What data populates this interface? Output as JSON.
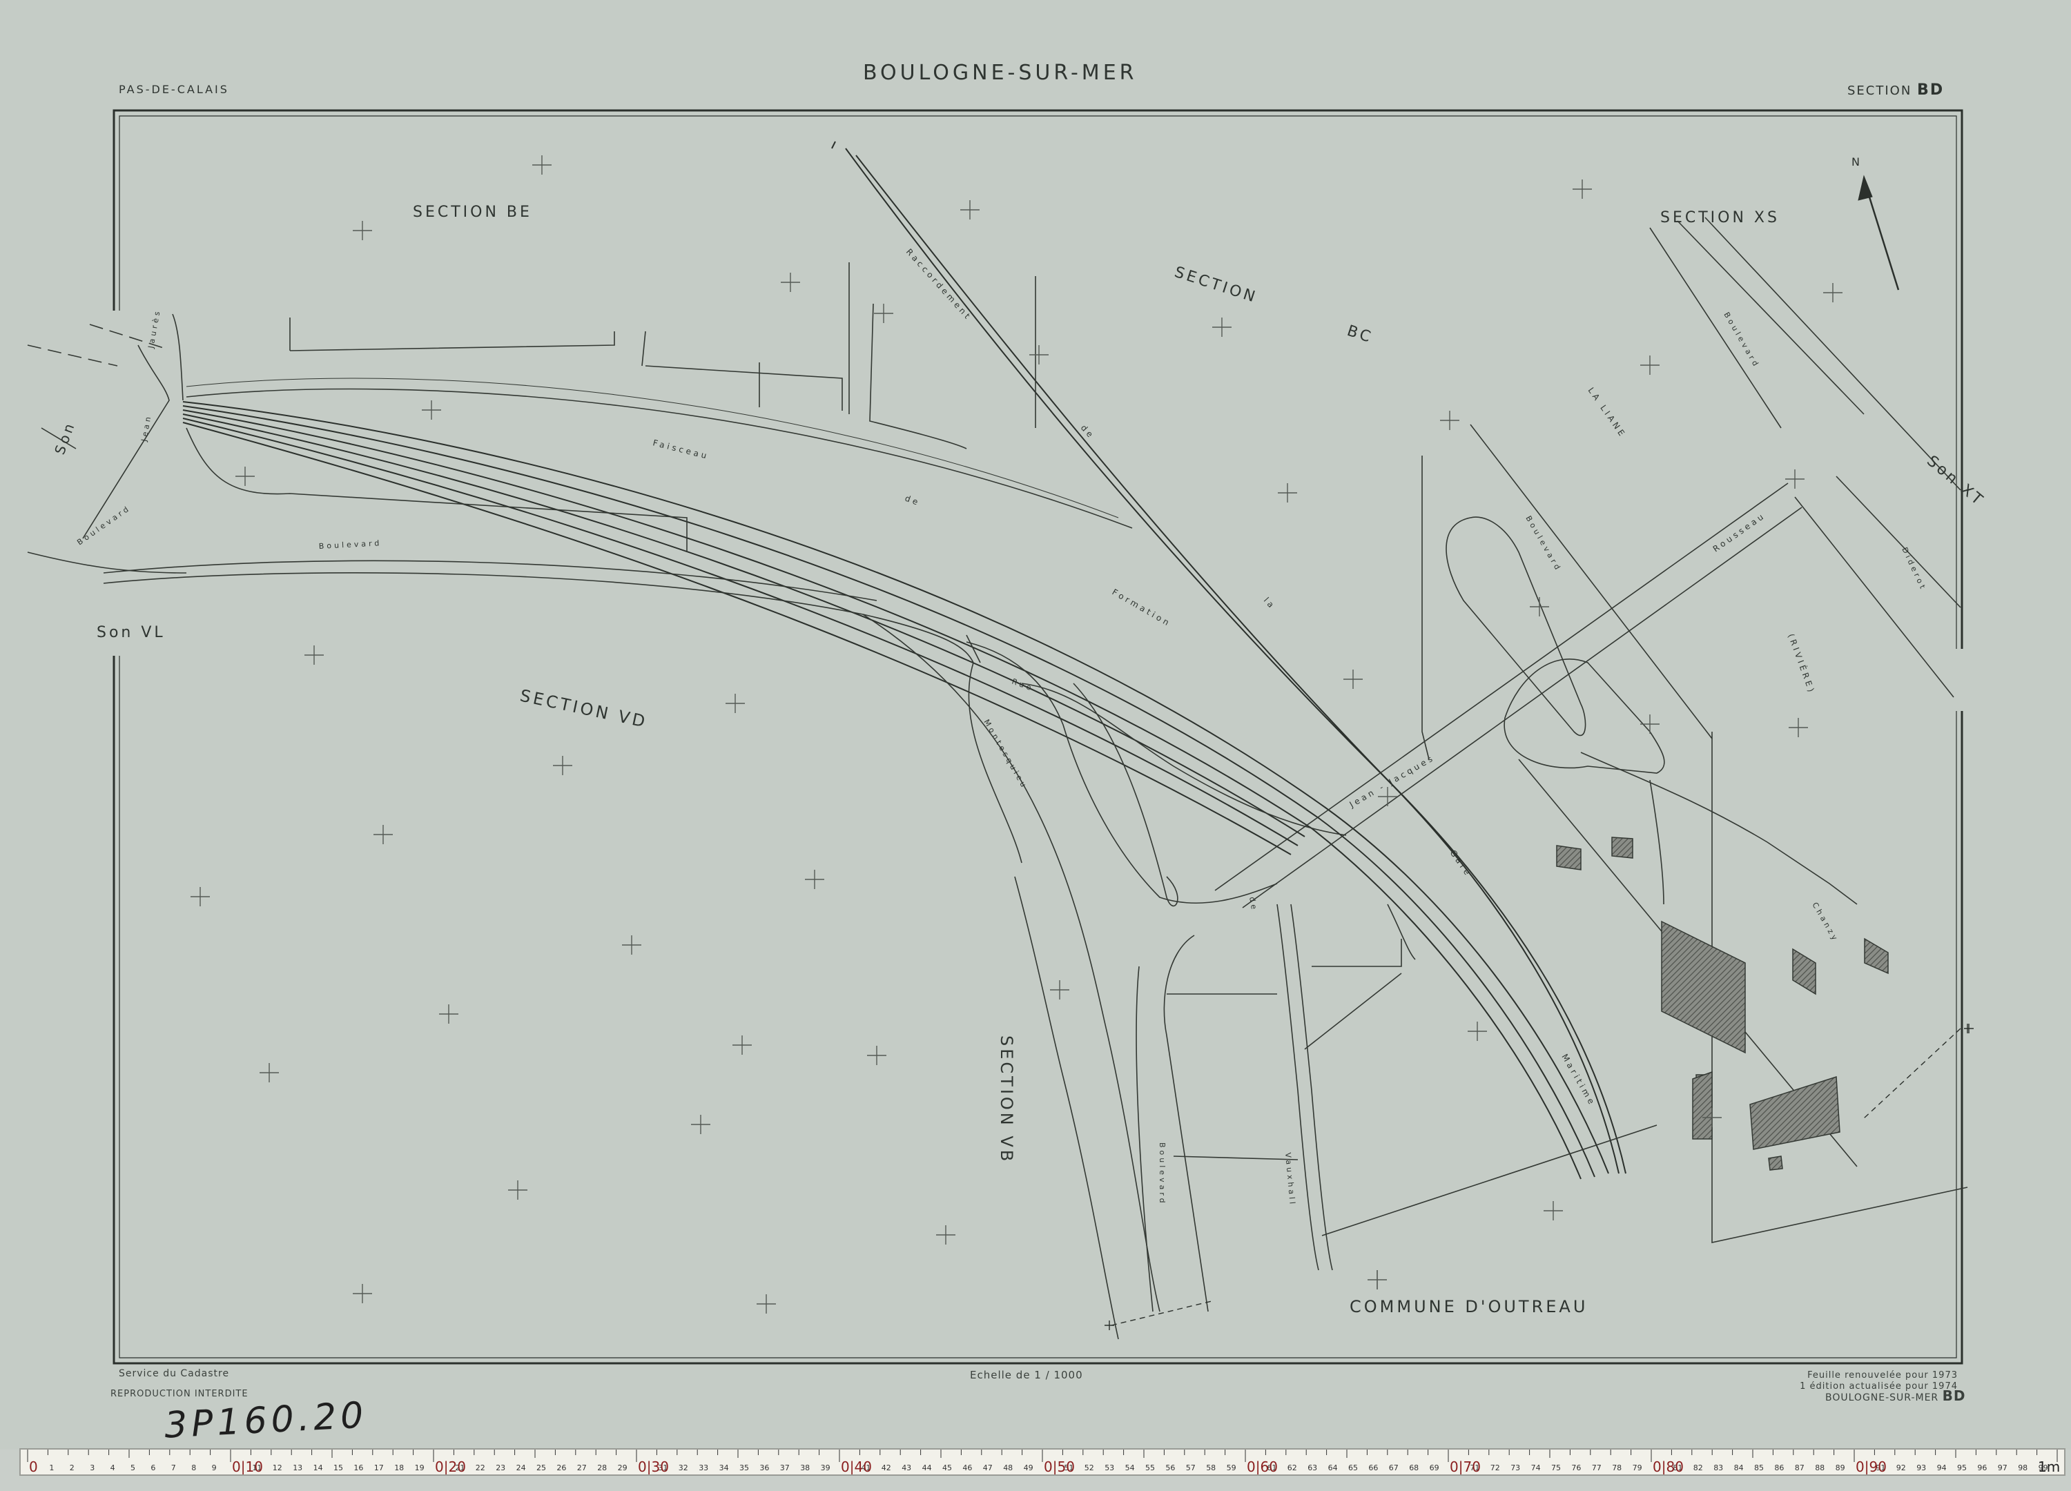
{
  "header": {
    "department": "PAS-DE-CALAIS",
    "commune": "BOULOGNE-SUR-MER",
    "section_word": "SECTION",
    "section_code": "BD"
  },
  "labels": {
    "section_be": "SECTION  BE",
    "section_bc_1": "SECTION",
    "section_bc_2": "BC",
    "section_xs": "SECTION  XS",
    "section_vd": "SECTION   VD",
    "section_vb": "SECTION  VB",
    "son_vl": "Son VL",
    "son_xt": "Son XT",
    "son_left": "Son",
    "commune_outreau": "COMMUNE       D'OUTREAU"
  },
  "streets": {
    "raccordement": "Raccordement",
    "faisceau": "Faisceau",
    "de": "de",
    "formation": "Formation",
    "la": "la",
    "gare": "Gare",
    "maritime": "Maritime",
    "boulevard": "Boulevard",
    "jean": "Jean",
    "jaures": "Jaurès",
    "jean_jacques": "Jean - Jacques",
    "rousseau": "Rousseau",
    "la_liane": "LA  LIANE",
    "riviere": "(RIVIÈRE)",
    "diderot": "Diderot",
    "chanzy": "Chanzy",
    "rue": "Rue",
    "montesquieu": "Montesquieu",
    "vauxhall": "Vauxhall"
  },
  "footer": {
    "service": "Service du Cadastre",
    "reproduction": "REPRODUCTION  INTERDITE",
    "scale": "Echelle de  1 / 1000",
    "renewed": "Feuille renouvelée pour 1973",
    "edition": "1  édition actualisée pour 1974",
    "sheet_name": "BOULOGNE-SUR-MER",
    "sheet_code": "BD"
  },
  "handwritten": "3P160.20",
  "ruler": {
    "unit_end": "1m",
    "major_labels": [
      "0",
      "0|10",
      "0|20",
      "0|30",
      "0|40",
      "0|50",
      "0|60",
      "0|70",
      "0|80",
      "0|90",
      "1m"
    ]
  },
  "colors": {
    "paper": "#c5ccc6",
    "ink": "#2f3531",
    "hatch": "#6b6e69"
  }
}
